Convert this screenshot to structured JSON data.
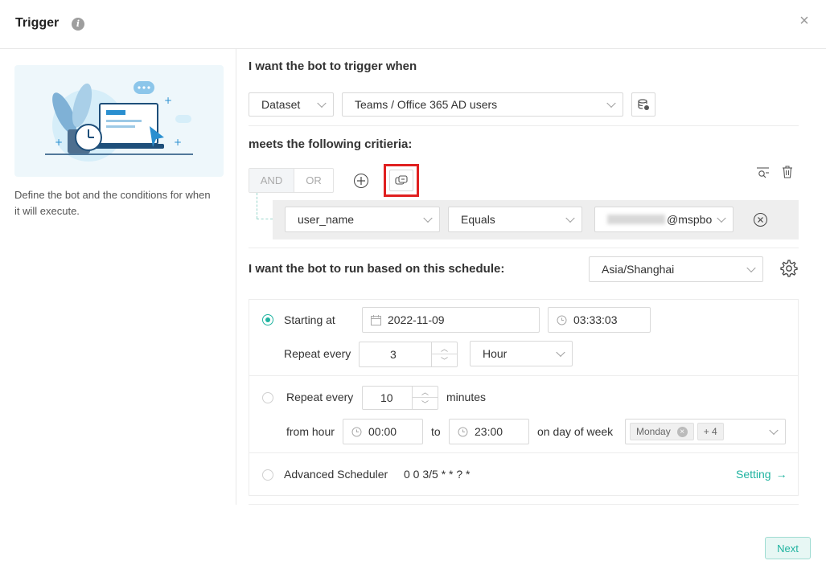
{
  "dialog": {
    "title": "Trigger",
    "info_glyph": "i",
    "close_glyph": "×"
  },
  "left_panel": {
    "description": "Define the bot and the conditions for when it will execute."
  },
  "trigger": {
    "heading": "I want the bot to trigger when",
    "source_type": "Dataset",
    "dataset": "Teams / Office 365 AD users"
  },
  "criteria": {
    "heading": "meets the following critieria:",
    "and_label": "AND",
    "or_label": "OR",
    "condition": {
      "field": "user_name",
      "operator": "Equals",
      "value_suffix": "@mspbo"
    }
  },
  "schedule": {
    "heading": "I want the bot to run based on this schedule:",
    "timezone": "Asia/Shanghai",
    "option1": {
      "label": "Starting at",
      "date": "2022-11-09",
      "time": "03:33:03",
      "repeat_label": "Repeat every",
      "repeat_value": "3",
      "repeat_unit": "Hour"
    },
    "option2": {
      "label": "Repeat every",
      "repeat_value": "10",
      "unit_label": "minutes",
      "from_label": "from hour",
      "from_value": "00:00",
      "to_label": "to",
      "to_value": "23:00",
      "day_label": "on day of week",
      "day_tag": "Monday",
      "more_tag": "+ 4"
    },
    "option3": {
      "label": "Advanced Scheduler",
      "cron": "0 0 3/5 * * ? *",
      "setting_label": "Setting",
      "setting_arrow": "→"
    }
  },
  "footer": {
    "next_label": "Next"
  },
  "colors": {
    "accent": "#1fb3a0",
    "highlight": "#e02020"
  }
}
